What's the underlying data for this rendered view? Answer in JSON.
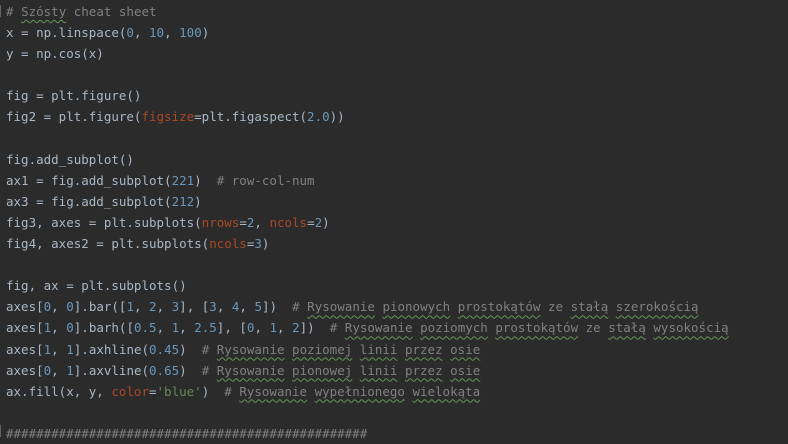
{
  "editor": {
    "theme": {
      "background": "#2b2b2b",
      "text": "#a9b7c6",
      "comment": "#808080",
      "number": "#6897bb",
      "kwarg": "#aa4926",
      "string": "#6a8759",
      "spellcheck_underline": "#629755"
    },
    "lines": [
      [
        {
          "t": "comment",
          "v": "# "
        },
        {
          "t": "comment-typo",
          "v": "Szósty"
        },
        {
          "t": "comment",
          "v": " cheat sheet"
        }
      ],
      [
        {
          "t": "plain",
          "v": "x = np.linspace("
        },
        {
          "t": "number",
          "v": "0"
        },
        {
          "t": "plain",
          "v": ", "
        },
        {
          "t": "number",
          "v": "10"
        },
        {
          "t": "plain",
          "v": ", "
        },
        {
          "t": "number",
          "v": "100"
        },
        {
          "t": "plain",
          "v": ")"
        }
      ],
      [
        {
          "t": "plain",
          "v": "y = np.cos(x)"
        }
      ],
      [],
      [
        {
          "t": "plain",
          "v": "fig = plt.figure()"
        }
      ],
      [
        {
          "t": "plain",
          "v": "fig2 = plt.figure("
        },
        {
          "t": "kwarg",
          "v": "figsize"
        },
        {
          "t": "plain",
          "v": "=plt.figaspect("
        },
        {
          "t": "number",
          "v": "2.0"
        },
        {
          "t": "plain",
          "v": "))"
        }
      ],
      [],
      [
        {
          "t": "plain",
          "v": "fig.add_subplot()"
        }
      ],
      [
        {
          "t": "plain",
          "v": "ax1 = fig.add_subplot("
        },
        {
          "t": "number",
          "v": "221"
        },
        {
          "t": "plain",
          "v": ")  "
        },
        {
          "t": "comment",
          "v": "# row-col-num"
        }
      ],
      [
        {
          "t": "plain",
          "v": "ax3 = fig.add_subplot("
        },
        {
          "t": "number",
          "v": "212"
        },
        {
          "t": "plain",
          "v": ")"
        }
      ],
      [
        {
          "t": "plain",
          "v": "fig3, axes = plt.subplots("
        },
        {
          "t": "kwarg",
          "v": "nrows"
        },
        {
          "t": "plain",
          "v": "="
        },
        {
          "t": "number",
          "v": "2"
        },
        {
          "t": "plain",
          "v": ", "
        },
        {
          "t": "kwarg",
          "v": "ncols"
        },
        {
          "t": "plain",
          "v": "="
        },
        {
          "t": "number",
          "v": "2"
        },
        {
          "t": "plain",
          "v": ")"
        }
      ],
      [
        {
          "t": "plain",
          "v": "fig4, axes2 = plt.subplots("
        },
        {
          "t": "kwarg",
          "v": "ncols"
        },
        {
          "t": "plain",
          "v": "="
        },
        {
          "t": "number",
          "v": "3"
        },
        {
          "t": "plain",
          "v": ")"
        }
      ],
      [],
      [
        {
          "t": "plain",
          "v": "fig, ax = plt.subplots()"
        }
      ],
      [
        {
          "t": "plain",
          "v": "axes["
        },
        {
          "t": "number",
          "v": "0"
        },
        {
          "t": "plain",
          "v": ", "
        },
        {
          "t": "number",
          "v": "0"
        },
        {
          "t": "plain",
          "v": "].bar(["
        },
        {
          "t": "number",
          "v": "1"
        },
        {
          "t": "plain",
          "v": ", "
        },
        {
          "t": "number",
          "v": "2"
        },
        {
          "t": "plain",
          "v": ", "
        },
        {
          "t": "number",
          "v": "3"
        },
        {
          "t": "plain",
          "v": "], ["
        },
        {
          "t": "number",
          "v": "3"
        },
        {
          "t": "plain",
          "v": ", "
        },
        {
          "t": "number",
          "v": "4"
        },
        {
          "t": "plain",
          "v": ", "
        },
        {
          "t": "number",
          "v": "5"
        },
        {
          "t": "plain",
          "v": "])  "
        },
        {
          "t": "comment",
          "v": "# "
        },
        {
          "t": "comment-typo",
          "v": "Rysowanie"
        },
        {
          "t": "comment",
          "v": " "
        },
        {
          "t": "comment-typo",
          "v": "pionowych"
        },
        {
          "t": "comment",
          "v": " "
        },
        {
          "t": "comment-typo",
          "v": "prostokątów"
        },
        {
          "t": "comment",
          "v": " ze "
        },
        {
          "t": "comment-typo",
          "v": "stałą"
        },
        {
          "t": "comment",
          "v": " "
        },
        {
          "t": "comment-typo",
          "v": "szerokością"
        }
      ],
      [
        {
          "t": "plain",
          "v": "axes["
        },
        {
          "t": "number",
          "v": "1"
        },
        {
          "t": "plain",
          "v": ", "
        },
        {
          "t": "number",
          "v": "0"
        },
        {
          "t": "plain",
          "v": "].barh(["
        },
        {
          "t": "number",
          "v": "0.5"
        },
        {
          "t": "plain",
          "v": ", "
        },
        {
          "t": "number",
          "v": "1"
        },
        {
          "t": "plain",
          "v": ", "
        },
        {
          "t": "number",
          "v": "2.5"
        },
        {
          "t": "plain",
          "v": "], ["
        },
        {
          "t": "number",
          "v": "0"
        },
        {
          "t": "plain",
          "v": ", "
        },
        {
          "t": "number",
          "v": "1"
        },
        {
          "t": "plain",
          "v": ", "
        },
        {
          "t": "number",
          "v": "2"
        },
        {
          "t": "plain",
          "v": "])  "
        },
        {
          "t": "comment",
          "v": "# "
        },
        {
          "t": "comment-typo",
          "v": "Rysowanie"
        },
        {
          "t": "comment",
          "v": " "
        },
        {
          "t": "comment-typo",
          "v": "poziomych"
        },
        {
          "t": "comment",
          "v": " "
        },
        {
          "t": "comment-typo",
          "v": "prostokątów"
        },
        {
          "t": "comment",
          "v": " ze "
        },
        {
          "t": "comment-typo",
          "v": "stałą"
        },
        {
          "t": "comment",
          "v": " "
        },
        {
          "t": "comment-typo",
          "v": "wysokością"
        }
      ],
      [
        {
          "t": "plain",
          "v": "axes["
        },
        {
          "t": "number",
          "v": "1"
        },
        {
          "t": "plain",
          "v": ", "
        },
        {
          "t": "number",
          "v": "1"
        },
        {
          "t": "plain",
          "v": "].axhline("
        },
        {
          "t": "number",
          "v": "0.45"
        },
        {
          "t": "plain",
          "v": ")  "
        },
        {
          "t": "comment",
          "v": "# "
        },
        {
          "t": "comment-typo",
          "v": "Rysowanie"
        },
        {
          "t": "comment",
          "v": " "
        },
        {
          "t": "comment-typo",
          "v": "poziomej"
        },
        {
          "t": "comment",
          "v": " "
        },
        {
          "t": "comment-typo",
          "v": "linii"
        },
        {
          "t": "comment",
          "v": " "
        },
        {
          "t": "comment-typo",
          "v": "przez"
        },
        {
          "t": "comment",
          "v": " "
        },
        {
          "t": "comment-typo",
          "v": "osie"
        }
      ],
      [
        {
          "t": "plain",
          "v": "axes["
        },
        {
          "t": "number",
          "v": "0"
        },
        {
          "t": "plain",
          "v": ", "
        },
        {
          "t": "number",
          "v": "1"
        },
        {
          "t": "plain",
          "v": "].axvline("
        },
        {
          "t": "number",
          "v": "0.65"
        },
        {
          "t": "plain",
          "v": ")  "
        },
        {
          "t": "comment",
          "v": "# "
        },
        {
          "t": "comment-typo",
          "v": "Rysowanie"
        },
        {
          "t": "comment",
          "v": " "
        },
        {
          "t": "comment-typo",
          "v": "pionowej"
        },
        {
          "t": "comment",
          "v": " "
        },
        {
          "t": "comment-typo",
          "v": "linii"
        },
        {
          "t": "comment",
          "v": " "
        },
        {
          "t": "comment-typo",
          "v": "przez"
        },
        {
          "t": "comment",
          "v": " "
        },
        {
          "t": "comment-typo",
          "v": "osie"
        }
      ],
      [
        {
          "t": "plain",
          "v": "ax.fill(x, y, "
        },
        {
          "t": "kwarg",
          "v": "color"
        },
        {
          "t": "plain",
          "v": "="
        },
        {
          "t": "string",
          "v": "'blue'"
        },
        {
          "t": "plain",
          "v": ")  "
        },
        {
          "t": "comment",
          "v": "# "
        },
        {
          "t": "comment-typo",
          "v": "Rysowanie"
        },
        {
          "t": "comment",
          "v": " "
        },
        {
          "t": "comment-typo",
          "v": "wypełnionego"
        },
        {
          "t": "comment",
          "v": " "
        },
        {
          "t": "comment-typo",
          "v": "wielokąta"
        }
      ],
      [],
      [
        {
          "t": "comment",
          "v": "################################################"
        }
      ]
    ]
  }
}
